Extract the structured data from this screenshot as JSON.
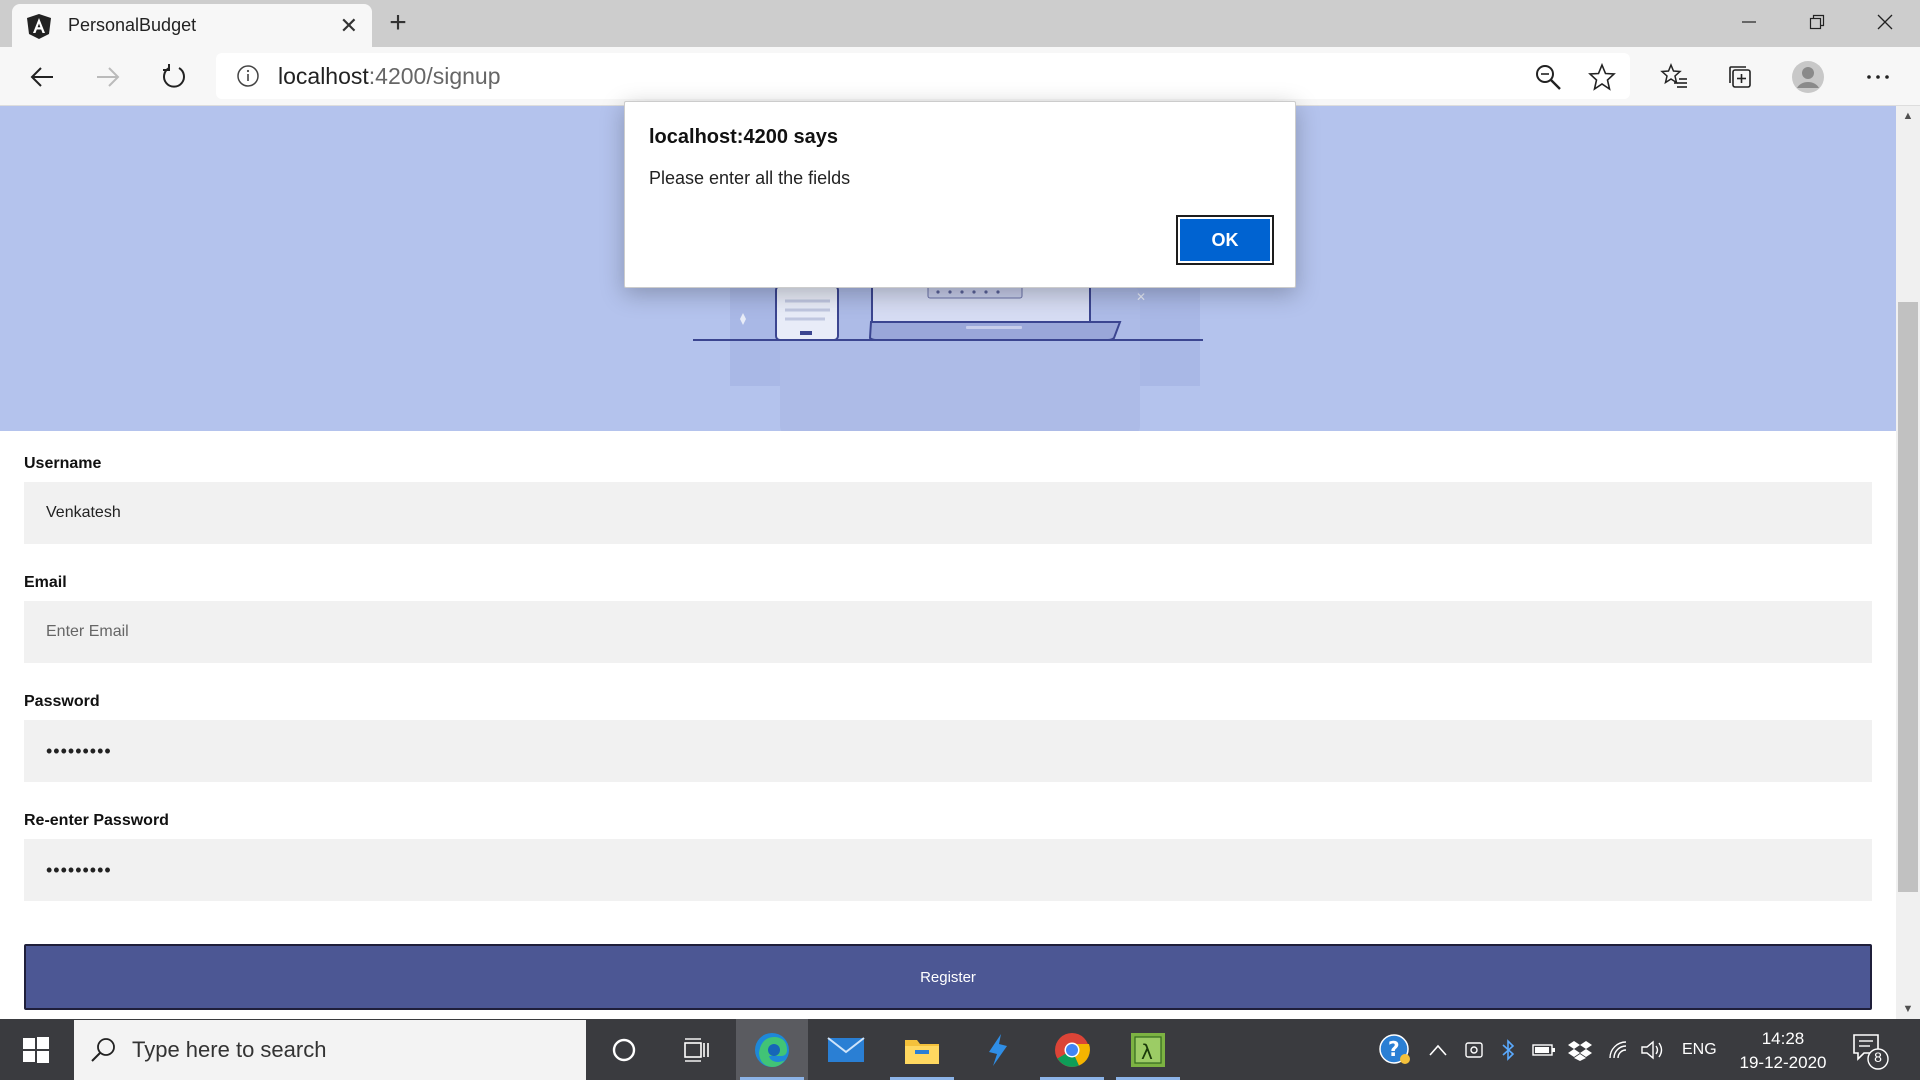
{
  "browser": {
    "tab_title": "PersonalBudget",
    "url_host": "localhost",
    "url_path": ":4200/signup"
  },
  "dialog": {
    "title": "localhost:4200 says",
    "message": "Please enter all the fields",
    "ok_label": "OK"
  },
  "form": {
    "username_label": "Username",
    "username_value": "Venkatesh",
    "email_label": "Email",
    "email_placeholder": "Enter Email",
    "password_label": "Password",
    "password_value": "•••••••••",
    "reenter_label": "Re-enter Password",
    "reenter_value": "•••••••••",
    "register_label": "Register"
  },
  "taskbar": {
    "search_placeholder": "Type here to search",
    "language": "ENG",
    "time": "14:28",
    "date": "19-12-2020",
    "notification_count": "8"
  },
  "colors": {
    "hero_bg": "#b4c3ed",
    "register_bg": "#4c5794",
    "ok_bg": "#0063d1",
    "taskbar_bg": "#3a3b3f"
  }
}
